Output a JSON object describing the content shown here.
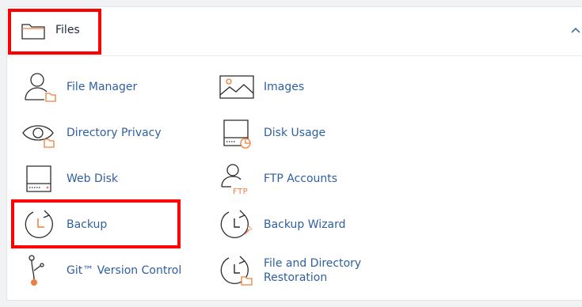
{
  "section": {
    "title": "Files",
    "icon": "folder-icon",
    "collapse_icon": "chevron-up-icon"
  },
  "items": [
    {
      "label": "File Manager",
      "icon": "file-manager-icon"
    },
    {
      "label": "Images",
      "icon": "images-icon"
    },
    {
      "label": "Directory Privacy",
      "icon": "directory-privacy-icon"
    },
    {
      "label": "Disk Usage",
      "icon": "disk-usage-icon"
    },
    {
      "label": "Web Disk",
      "icon": "web-disk-icon"
    },
    {
      "label": "FTP Accounts",
      "icon": "ftp-accounts-icon"
    },
    {
      "label": "Backup",
      "icon": "backup-icon"
    },
    {
      "label": "Backup Wizard",
      "icon": "backup-wizard-icon"
    },
    {
      "label": "Git™ Version Control",
      "icon": "git-icon"
    },
    {
      "label": "File and Directory Restoration",
      "icon": "restoration-icon"
    }
  ],
  "colors": {
    "link": "#2f5f9e",
    "accent": "#f07d3c",
    "highlight": "#ff0000",
    "icon_stroke": "#2b2b2b"
  }
}
